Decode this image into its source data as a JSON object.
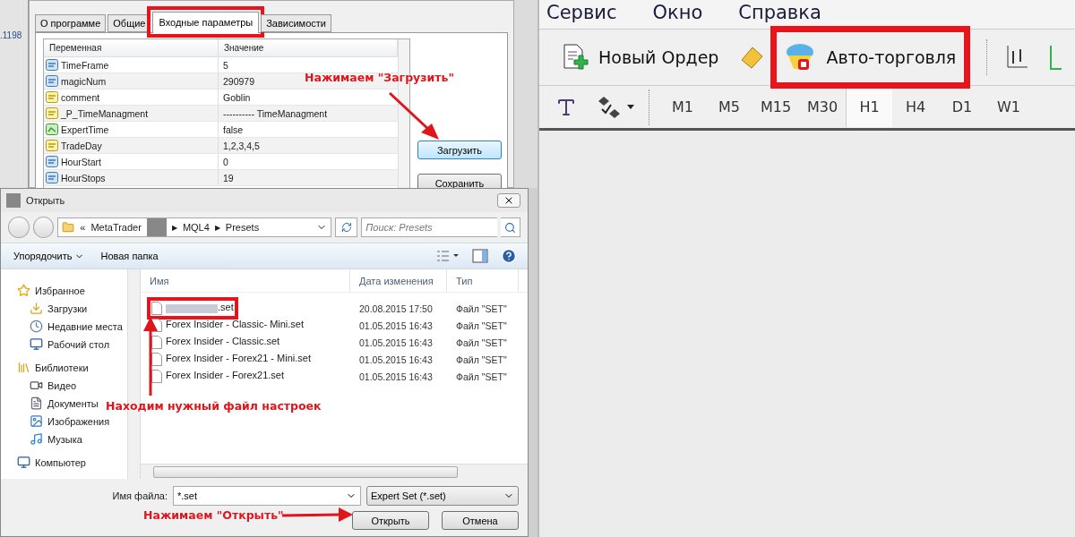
{
  "chart_edge_text": ".1198",
  "params_dialog": {
    "tabs": [
      {
        "label": "О программе",
        "selected": false,
        "highlighted": false
      },
      {
        "label": "Общие",
        "selected": false,
        "highlighted": false
      },
      {
        "label": "Входные параметры",
        "selected": true,
        "highlighted": true
      },
      {
        "label": "Зависимости",
        "selected": false,
        "highlighted": false
      }
    ],
    "columns": [
      "Переменная",
      "Значение"
    ],
    "rows": [
      {
        "kind": "int",
        "name": "TimeFrame",
        "value": "5"
      },
      {
        "kind": "int",
        "name": "magicNum",
        "value": "290979"
      },
      {
        "kind": "text",
        "name": "comment",
        "value": "Goblin"
      },
      {
        "kind": "text",
        "name": "_P_TimeManagment",
        "value": "---------- TimeManagment"
      },
      {
        "kind": "bool",
        "name": "ExpertTime",
        "value": "false"
      },
      {
        "kind": "text",
        "name": "TradeDay",
        "value": "1,2,3,4,5"
      },
      {
        "kind": "int",
        "name": "HourStart",
        "value": "0"
      },
      {
        "kind": "int",
        "name": "HourStops",
        "value": "19"
      }
    ],
    "buttons": [
      {
        "label": "Загрузить",
        "focused": true
      },
      {
        "label": "Сохранить",
        "focused": false
      }
    ]
  },
  "open_dialog": {
    "title": "Открыть",
    "path_prefix": "«",
    "path_separator": "▶",
    "path": [
      "MetaTrader",
      "MQL4",
      "Presets"
    ],
    "search": {
      "placeholder": "Поиск: Presets"
    },
    "commands": [
      "Упорядочить",
      "Новая папка"
    ],
    "nav": [
      {
        "label": "Избранное",
        "kind": "star",
        "children": [
          {
            "label": "Загрузки",
            "kind": "download"
          },
          {
            "label": "Недавние места",
            "kind": "recent"
          },
          {
            "label": "Рабочий стол",
            "kind": "desktop"
          }
        ]
      },
      {
        "label": "Библиотеки",
        "kind": "library",
        "children": [
          {
            "label": "Видео",
            "kind": "video"
          },
          {
            "label": "Документы",
            "kind": "document"
          },
          {
            "label": "Изображения",
            "kind": "image"
          },
          {
            "label": "Музыка",
            "kind": "music"
          }
        ]
      },
      {
        "label": "Компьютер",
        "kind": "computer"
      }
    ],
    "columns": [
      "Имя",
      "Дата изменения",
      "Тип"
    ],
    "files": [
      {
        "name": ".set",
        "date": "20.08.2015 17:50",
        "type": "Файл \"SET\"",
        "highlighted": true
      },
      {
        "name": "Forex Insider - Classic- Mini.set",
        "date": "01.05.2015 16:43",
        "type": "Файл \"SET\"",
        "highlighted": false
      },
      {
        "name": "Forex Insider - Classic.set",
        "date": "01.05.2015 16:43",
        "type": "Файл \"SET\"",
        "highlighted": false
      },
      {
        "name": "Forex Insider - Forex21 - Mini.set",
        "date": "01.05.2015 16:43",
        "type": "Файл \"SET\"",
        "highlighted": false
      },
      {
        "name": "Forex Insider - Forex21.set",
        "date": "01.05.2015 16:43",
        "type": "Файл \"SET\"",
        "highlighted": false
      }
    ],
    "filename_label": "Имя файла:",
    "filename": "*.set",
    "filter": "Expert Set (*.set)",
    "buttons": [
      "Открыть",
      "Отмена"
    ]
  },
  "menu": [
    "Сервис",
    "Окно",
    "Справка"
  ],
  "toolbar": [
    {
      "kind": "new_order",
      "label": "Новый Ордер",
      "highlighted": false
    },
    {
      "kind": "auto_trading",
      "label": "Авто-торговля",
      "highlighted": true
    }
  ],
  "timeframes": [
    {
      "label": "M1",
      "selected": false
    },
    {
      "label": "M5",
      "selected": false
    },
    {
      "label": "M15",
      "selected": false
    },
    {
      "label": "M30",
      "selected": false
    },
    {
      "label": "H1",
      "selected": true
    },
    {
      "label": "H4",
      "selected": false
    },
    {
      "label": "D1",
      "selected": false
    },
    {
      "label": "W1",
      "selected": false
    }
  ],
  "annotations": [
    "Нажимаем \"Загрузить\"",
    "Находим нужный файл настроек",
    "Нажимаем \"Открыть\""
  ]
}
